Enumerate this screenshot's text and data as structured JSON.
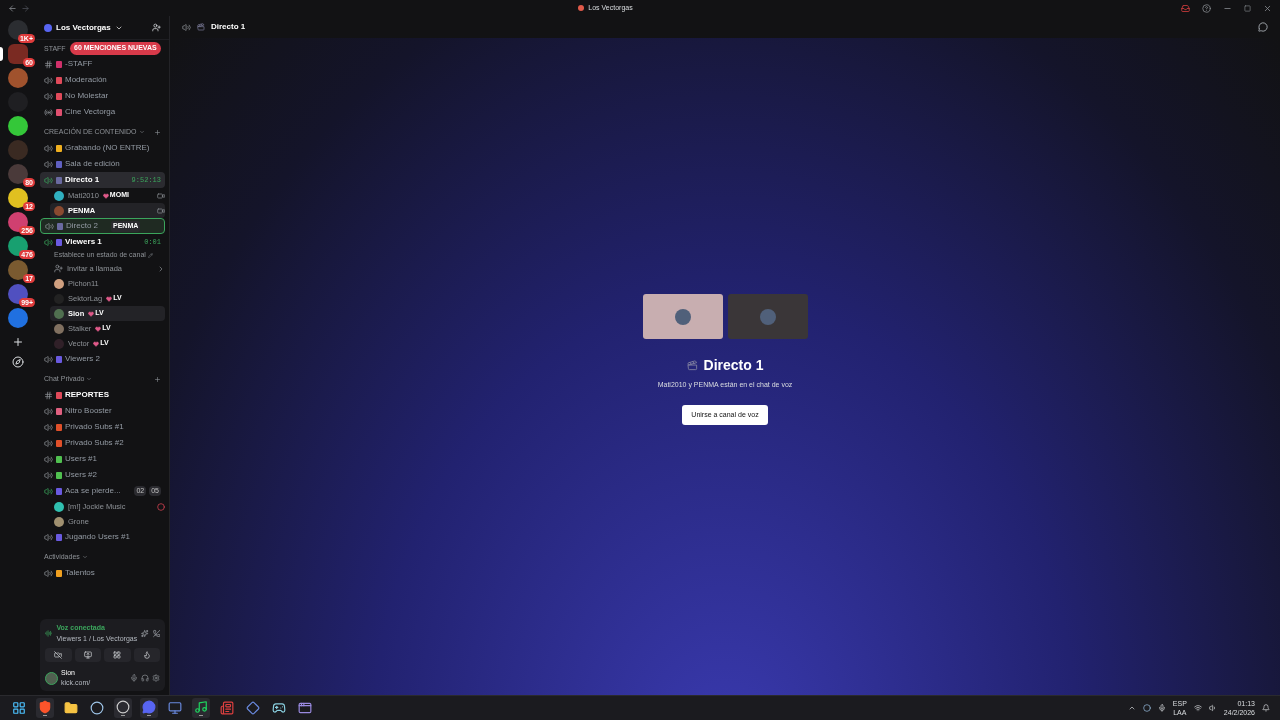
{
  "titlebar": {
    "title": "Los Vectorgas"
  },
  "servers": [
    {
      "badge": "1K+",
      "selected": false,
      "color": "#2b2d31"
    },
    {
      "badge": "60",
      "selected": true,
      "color": "#7a2a22"
    },
    {
      "selected": false,
      "color": "#a0522d"
    },
    {
      "selected": false,
      "color": "#1f1f22"
    },
    {
      "selected": false,
      "color": "#34c739"
    },
    {
      "selected": false,
      "color": "#3a2a22"
    },
    {
      "badge": "80",
      "selected": false,
      "color": "#4a3a3a"
    },
    {
      "badge": "12",
      "selected": false,
      "color": "#e0c020"
    },
    {
      "badge": "256",
      "selected": false,
      "color": "#d04070"
    },
    {
      "badge": "476",
      "selected": false,
      "color": "#18a070"
    },
    {
      "badge": "17",
      "selected": false,
      "color": "#7a5a30"
    },
    {
      "badge": "99+",
      "selected": false,
      "color": "#5050c0"
    },
    {
      "selected": false,
      "color": "#2070e0"
    }
  ],
  "sidebar": {
    "server_name": "Los Vectorgas",
    "mentions": "60 MENCIONES NUEVAS",
    "categories": [
      {
        "name": "STAFF",
        "channels": [
          {
            "kind": "text",
            "name": "-STAFF",
            "color": "#d0306a",
            "selected": false,
            "active": false,
            "bold": false
          },
          {
            "kind": "voice",
            "name": "Moderación",
            "color": "#e04a5a",
            "selected": false,
            "active": false,
            "bold": false
          },
          {
            "kind": "voice",
            "name": "No Molestar",
            "color": "#e04a5a",
            "selected": false,
            "active": false,
            "bold": false
          },
          {
            "kind": "stage",
            "name": "Cine Vectorga",
            "color": "#e05070",
            "selected": false,
            "active": false,
            "bold": false
          }
        ]
      },
      {
        "name": "CREACIÓN DE CONTENIDO",
        "add": true,
        "channels": [
          {
            "kind": "voice",
            "name": "Grabando (NO ENTRE)",
            "color": "#f0b020",
            "selected": false,
            "active": false,
            "bold": false
          },
          {
            "kind": "voice",
            "name": "Sala de edición",
            "color": "#6060c0",
            "selected": false,
            "active": false,
            "bold": false
          },
          {
            "kind": "voice",
            "name": "Directo 1",
            "color": "#6a6aa0",
            "selected": true,
            "active": true,
            "bold": true,
            "timer": "9:52:13",
            "members": [
              {
                "kind": "user",
                "name": "Mati2010",
                "badge": "MOMI",
                "self": false,
                "camera": true,
                "alert": false,
                "color": "#30b0c0"
              },
              {
                "kind": "user",
                "name": "PENMA",
                "self": true,
                "camera": true,
                "alert": false,
                "color": "#8a4a30"
              }
            ]
          },
          {
            "kind": "voice",
            "name": "Directo 2",
            "color": "#6a6aa0",
            "selected": false,
            "active": false,
            "bold": false,
            "drop_target": true,
            "drag_ghost": "PENMA"
          },
          {
            "kind": "voice",
            "name": "Viewers 1",
            "color": "#6a5ae0",
            "selected": false,
            "active": true,
            "bold": true,
            "timer": "0:01",
            "hint": "Establece un estado de canal",
            "members": [
              {
                "kind": "invite",
                "name": "Invitar a llamada"
              },
              {
                "kind": "user",
                "name": "Pichon11",
                "self": false,
                "camera": false,
                "alert": false,
                "color": "#d0a080"
              },
              {
                "kind": "user",
                "name": "SektorLag",
                "badge": "LV",
                "self": false,
                "camera": false,
                "alert": false,
                "color": "#222222"
              },
              {
                "kind": "user",
                "name": "Sion",
                "badge": "LV",
                "self": true,
                "camera": false,
                "alert": false,
                "color": "#507050"
              },
              {
                "kind": "user",
                "name": "Stalker",
                "badge": "LV",
                "self": false,
                "camera": false,
                "alert": false,
                "color": "#807060"
              },
              {
                "kind": "user",
                "name": "Vector",
                "badge": "LV",
                "self": false,
                "camera": false,
                "alert": false,
                "color": "#302028"
              }
            ]
          },
          {
            "kind": "voice",
            "name": "Viewers 2",
            "color": "#6a5ae0",
            "selected": false,
            "active": false,
            "bold": false
          }
        ]
      },
      {
        "name": "Chat Privado",
        "add": true,
        "channels": [
          {
            "kind": "text",
            "name": "REPORTES",
            "color": "#e04a5a",
            "selected": false,
            "active": false,
            "bold": true
          },
          {
            "kind": "voice",
            "name": "Nitro Booster",
            "color": "#e06080",
            "selected": false,
            "active": false,
            "bold": false
          },
          {
            "kind": "voice",
            "name": "Privado Subs #1",
            "color": "#e0502a",
            "selected": false,
            "active": false,
            "bold": false
          },
          {
            "kind": "voice",
            "name": "Privado Subs #2",
            "color": "#e0502a",
            "selected": false,
            "active": false,
            "bold": false
          },
          {
            "kind": "voice",
            "name": "Users #1",
            "color": "#50c050",
            "selected": false,
            "active": false,
            "bold": false
          },
          {
            "kind": "voice",
            "name": "Users #2",
            "color": "#50c050",
            "selected": false,
            "active": false,
            "bold": false
          },
          {
            "kind": "voice",
            "name": "Aca se pierde...",
            "color": "#6a5ae0",
            "selected": false,
            "active": true,
            "bold": false,
            "counts": [
              "02",
              "05"
            ],
            "members": [
              {
                "kind": "user",
                "name": "[m!] Jockie Music",
                "self": false,
                "camera": false,
                "alert": true,
                "color": "#30c0b0"
              },
              {
                "kind": "user",
                "name": "Grone",
                "self": false,
                "camera": false,
                "alert": false,
                "color": "#a09070"
              }
            ]
          },
          {
            "kind": "voice",
            "name": "Jugando Users #1",
            "color": "#6a5ae0",
            "selected": false,
            "active": false,
            "bold": false
          }
        ]
      },
      {
        "name": "Actividades",
        "add": false,
        "channels": [
          {
            "kind": "voice",
            "name": "Talentos",
            "color": "#f0a020",
            "selected": false,
            "active": false,
            "bold": false
          }
        ]
      }
    ]
  },
  "voice_panel": {
    "status": "Voz conectada",
    "location": "Viewers 1 / Los Vectorgas"
  },
  "user_panel": {
    "name": "Sion",
    "status": "kick.com/"
  },
  "channel_header": {
    "title": "Directo 1"
  },
  "stage": {
    "tiles": [
      {
        "color": "#c8aeb0"
      },
      {
        "color": "#3a3638"
      }
    ],
    "title": "Directo 1",
    "subtitle": "Mati2010 y PENMA están en el chat de voz",
    "button": "Unirse a canal de voz"
  },
  "taskbar": {
    "apps": [
      {
        "kind": "windows",
        "running": false
      },
      {
        "kind": "shield",
        "running": true
      },
      {
        "kind": "folder",
        "running": false
      },
      {
        "kind": "steam",
        "running": false
      },
      {
        "kind": "record",
        "running": true
      },
      {
        "kind": "chat",
        "running": true
      },
      {
        "kind": "monitor",
        "running": false
      },
      {
        "kind": "music",
        "running": true
      },
      {
        "kind": "news",
        "running": false
      },
      {
        "kind": "diamond",
        "running": false
      },
      {
        "kind": "gamepad",
        "running": false
      },
      {
        "kind": "window",
        "running": false
      }
    ],
    "lang": "ESP",
    "layout": "LAA",
    "time": "01:13",
    "date": "24/2/2026"
  }
}
